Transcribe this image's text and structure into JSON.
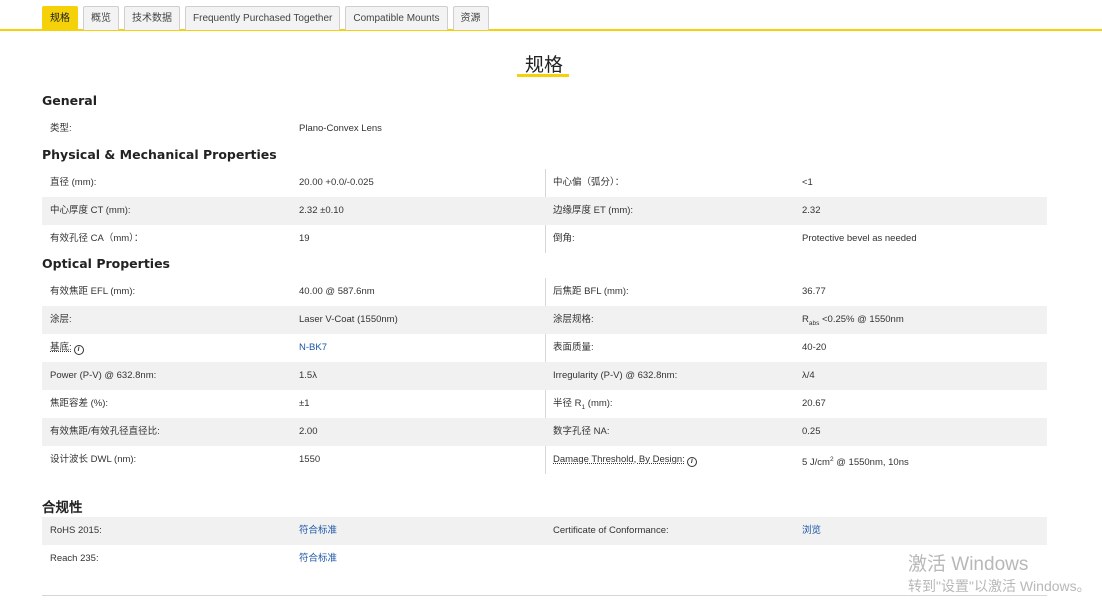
{
  "tabs": [
    "规格",
    "概览",
    "技术数据",
    "Frequently Purchased Together",
    "Compatible Mounts",
    "资源"
  ],
  "title": "规格",
  "sections": {
    "general": "General",
    "physical": "Physical & Mechanical Properties",
    "optical": "Optical Properties",
    "compliance": "合规性"
  },
  "general": {
    "type_label": "类型:",
    "type_value": "Plano-Convex Lens"
  },
  "physical": {
    "diameter_label": "直径 (mm):",
    "diameter_value": "20.00 +0.0/-0.025",
    "centering_label": "中心偏（弧分）：",
    "centering_value": "<1",
    "ct_label": "中心厚度 CT (mm):",
    "ct_value": "2.32 ±0.10",
    "et_label": "边缘厚度 ET (mm):",
    "et_value": "2.32",
    "ca_label": "有效孔径 CA（mm）：",
    "ca_value": "19",
    "bevel_label": "倒角:",
    "bevel_value": "Protective bevel as needed"
  },
  "optical": {
    "efl_label": "有效焦距 EFL (mm):",
    "efl_value": "40.00 @ 587.6nm",
    "bfl_label": "后焦距 BFL (mm):",
    "bfl_value": "36.77",
    "coating_label": "涂层:",
    "coating_value": "Laser V-Coat (1550nm)",
    "coating_spec_label": "涂层规格:",
    "coating_spec_r": "R",
    "coating_spec_sub": "abs",
    "coating_spec_value": " <0.25% @ 1550nm",
    "substrate_label": "基底:",
    "substrate_value": "N-BK7",
    "surface_label": "表面质量:",
    "surface_value": "40-20",
    "power_label": "Power (P-V) @ 632.8nm:",
    "power_value": "1.5λ",
    "irregularity_label": "Irregularity (P-V) @ 632.8nm:",
    "irregularity_value": "λ/4",
    "focal_tol_label": "焦距容差 (%):",
    "focal_tol_value": "±1",
    "radius_label_a": "半径 R",
    "radius_label_sub": "1",
    "radius_label_b": " (mm):",
    "radius_value": "20.67",
    "fnum_label": "有效焦距/有效孔径直径比:",
    "fnum_value": "2.00",
    "na_label": "数字孔径 NA:",
    "na_value": "0.25",
    "dwl_label": "设计波长 DWL (nm):",
    "dwl_value": "1550",
    "damage_label": "Damage Threshold, By Design:",
    "damage_value_a": "5 J/cm",
    "damage_value_sup": "2",
    "damage_value_b": " @ 1550nm, 10ns"
  },
  "compliance": {
    "rohs_label": "RoHS 2015:",
    "rohs_value": "符合标准",
    "coc_label": "Certificate of Conformance:",
    "coc_value": "浏览",
    "reach_label": "Reach 235:",
    "reach_value": "符合标准"
  },
  "watermark": {
    "line1": "激活 Windows",
    "line2": "转到\"设置\"以激活 Windows。"
  },
  "colors": {
    "accent": "#f5d10a",
    "link": "#1a56a8",
    "shade": "#f1f1f1"
  }
}
